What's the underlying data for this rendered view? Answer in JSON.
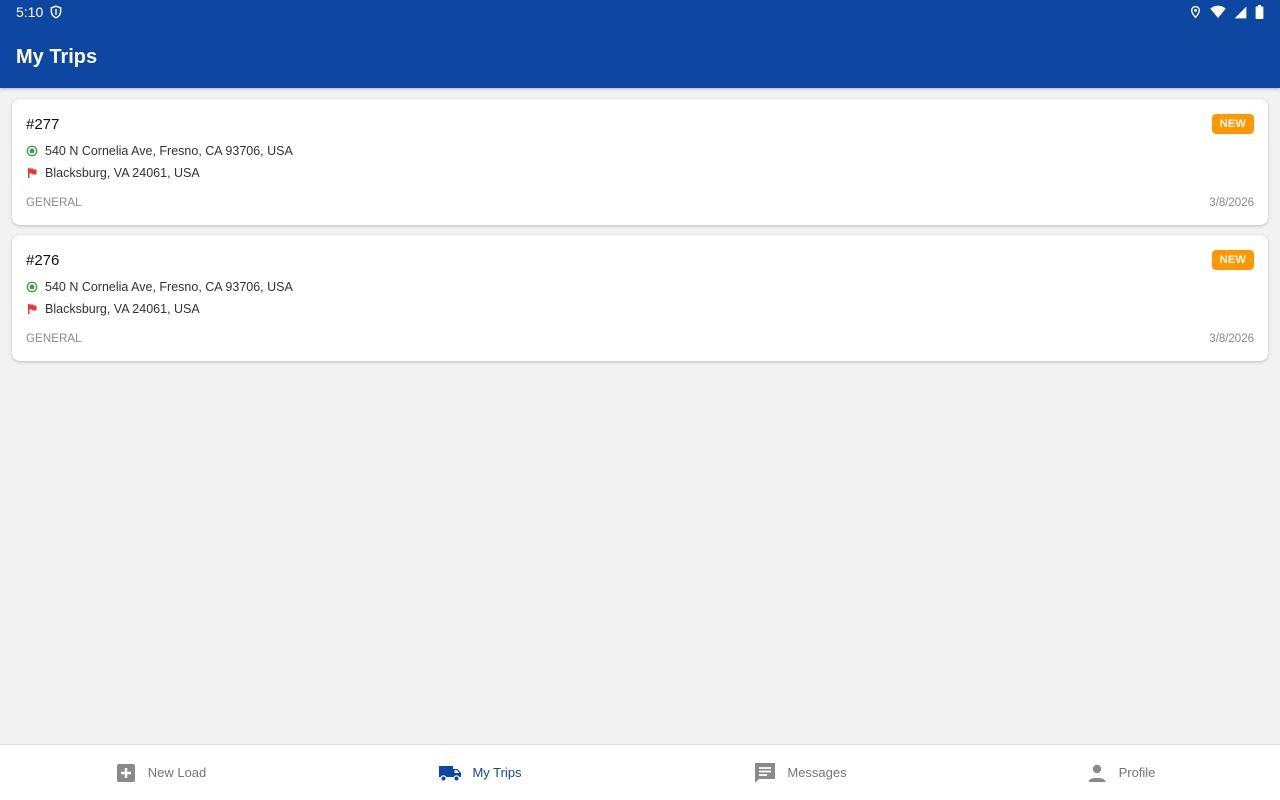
{
  "status_bar": {
    "time": "5:10",
    "icons": [
      "shield-icon",
      "location-icon",
      "wifi-icon",
      "signal-icon",
      "battery-icon"
    ]
  },
  "header": {
    "title": "My Trips"
  },
  "colors": {
    "primary": "#0d47a1",
    "badge": "#ff9800",
    "origin": "#43a047",
    "destination": "#e53935"
  },
  "trips": [
    {
      "id": "#277",
      "status": "NEW",
      "origin": "540 N Cornelia Ave, Fresno, CA 93706, USA",
      "destination": "Blacksburg, VA 24061, USA",
      "category": "GENERAL",
      "date": "3/8/2026"
    },
    {
      "id": "#276",
      "status": "NEW",
      "origin": "540 N Cornelia Ave, Fresno, CA 93706, USA",
      "destination": "Blacksburg, VA 24061, USA",
      "category": "GENERAL",
      "date": "3/8/2026"
    }
  ],
  "bottom_nav": [
    {
      "label": "New Load",
      "icon": "add-box-icon",
      "active": false
    },
    {
      "label": "My Trips",
      "icon": "truck-icon",
      "active": true
    },
    {
      "label": "Messages",
      "icon": "message-icon",
      "active": false
    },
    {
      "label": "Profile",
      "icon": "person-icon",
      "active": false
    }
  ]
}
